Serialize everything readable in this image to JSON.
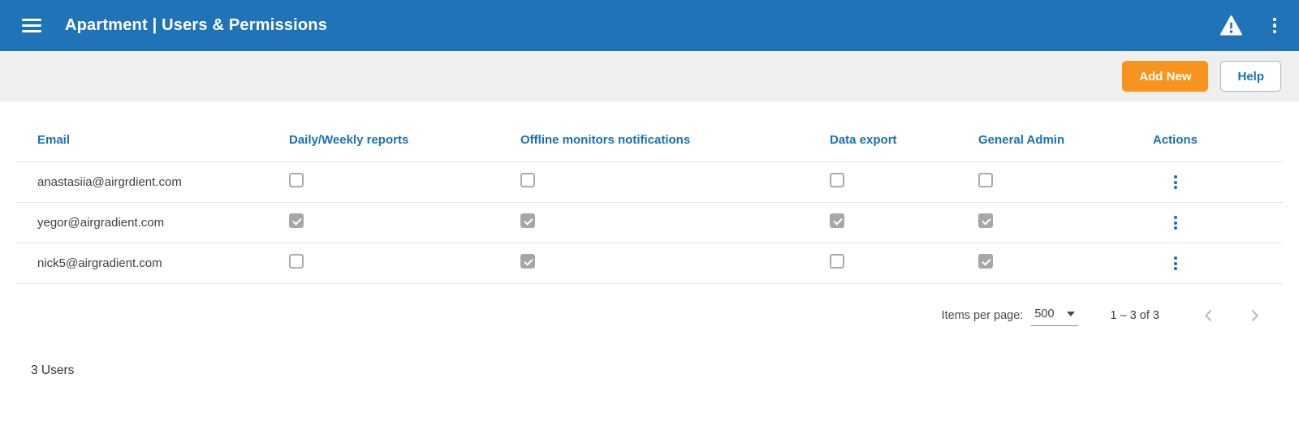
{
  "colors": {
    "appbar_blue": "#2173B8",
    "accent_orange": "#F7941E",
    "link_blue": "#1872B3",
    "toolbar_gray": "#EFEFEF",
    "checkbox_checked_gray": "#A7A7A7"
  },
  "header": {
    "title": "Apartment | Users & Permissions",
    "icons": {
      "menu": "hamburger-menu",
      "warning": "warning-triangle",
      "overflow": "kebab-vertical-dots"
    }
  },
  "toolbar": {
    "add_new_label": "Add New",
    "help_label": "Help"
  },
  "table": {
    "columns": {
      "email": "Email",
      "daily_weekly_reports": "Daily/Weekly reports",
      "offline_monitors_notifications": "Offline monitors notifications",
      "data_export": "Data export",
      "general_admin": "General Admin",
      "actions": "Actions"
    },
    "rows": [
      {
        "email": "anastasiia@airgrdient.com",
        "permissions": {
          "daily_weekly_reports": false,
          "offline_monitors_notifications": false,
          "data_export": false,
          "general_admin": false
        }
      },
      {
        "email": "yegor@airgradient.com",
        "permissions": {
          "daily_weekly_reports": true,
          "offline_monitors_notifications": true,
          "data_export": true,
          "general_admin": true
        }
      },
      {
        "email": "nick5@airgradient.com",
        "permissions": {
          "daily_weekly_reports": false,
          "offline_monitors_notifications": true,
          "data_export": false,
          "general_admin": true
        }
      }
    ]
  },
  "pagination": {
    "items_per_page_label": "Items per page:",
    "items_per_page_value": "500",
    "range_label": "1 – 3 of 3"
  },
  "footer": {
    "user_count_label": "3 Users"
  }
}
